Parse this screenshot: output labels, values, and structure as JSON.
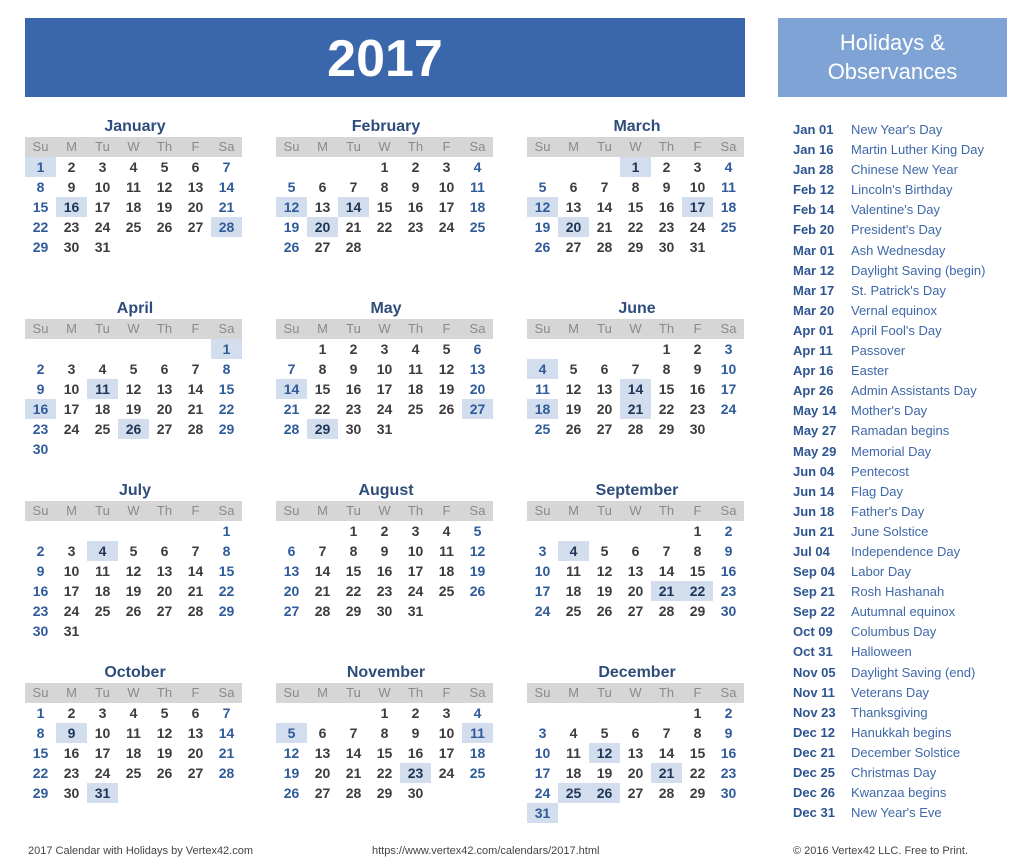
{
  "title": "2017",
  "holidays_title_1": "Holidays &",
  "holidays_title_2": "Observances",
  "weekdays": [
    "Su",
    "M",
    "Tu",
    "W",
    "Th",
    "F",
    "Sa"
  ],
  "months": [
    {
      "name": "January",
      "start": 0,
      "days": 31,
      "hl": [
        1,
        16,
        28
      ]
    },
    {
      "name": "February",
      "start": 3,
      "days": 28,
      "hl": [
        12,
        14,
        20
      ]
    },
    {
      "name": "March",
      "start": 3,
      "days": 31,
      "hl": [
        1,
        12,
        17,
        20
      ]
    },
    {
      "name": "April",
      "start": 6,
      "days": 30,
      "hl": [
        1,
        11,
        16,
        26
      ]
    },
    {
      "name": "May",
      "start": 1,
      "days": 31,
      "hl": [
        14,
        27,
        29
      ]
    },
    {
      "name": "June",
      "start": 4,
      "days": 30,
      "hl": [
        4,
        14,
        18,
        21
      ]
    },
    {
      "name": "July",
      "start": 6,
      "days": 31,
      "hl": [
        4
      ]
    },
    {
      "name": "August",
      "start": 2,
      "days": 31,
      "hl": []
    },
    {
      "name": "September",
      "start": 5,
      "days": 30,
      "hl": [
        4,
        21,
        22
      ]
    },
    {
      "name": "October",
      "start": 0,
      "days": 31,
      "hl": [
        9,
        31
      ]
    },
    {
      "name": "November",
      "start": 3,
      "days": 30,
      "hl": [
        5,
        11,
        23
      ]
    },
    {
      "name": "December",
      "start": 5,
      "days": 31,
      "hl": [
        12,
        21,
        25,
        26,
        31
      ]
    }
  ],
  "holidays": [
    [
      "Jan 01",
      "New Year's Day"
    ],
    [
      "Jan 16",
      "Martin Luther King Day"
    ],
    [
      "Jan 28",
      "Chinese New Year"
    ],
    [
      "Feb 12",
      "Lincoln's Birthday"
    ],
    [
      "Feb 14",
      "Valentine's Day"
    ],
    [
      "Feb 20",
      "President's Day"
    ],
    [
      "Mar 01",
      "Ash Wednesday"
    ],
    [
      "Mar 12",
      "Daylight Saving (begin)"
    ],
    [
      "Mar 17",
      "St. Patrick's Day"
    ],
    [
      "Mar 20",
      "Vernal equinox"
    ],
    [
      "Apr 01",
      "April Fool's Day"
    ],
    [
      "Apr 11",
      "Passover"
    ],
    [
      "Apr 16",
      "Easter"
    ],
    [
      "Apr 26",
      "Admin Assistants Day"
    ],
    [
      "May 14",
      "Mother's Day"
    ],
    [
      "May 27",
      "Ramadan begins"
    ],
    [
      "May 29",
      "Memorial Day"
    ],
    [
      "Jun 04",
      "Pentecost"
    ],
    [
      "Jun 14",
      "Flag Day"
    ],
    [
      "Jun 18",
      "Father's Day"
    ],
    [
      "Jun 21",
      "June Solstice"
    ],
    [
      "Jul 04",
      "Independence Day"
    ],
    [
      "Sep 04",
      "Labor Day"
    ],
    [
      "Sep 21",
      "Rosh Hashanah"
    ],
    [
      "Sep 22",
      "Autumnal equinox"
    ],
    [
      "Oct 09",
      "Columbus Day"
    ],
    [
      "Oct 31",
      "Halloween"
    ],
    [
      "Nov 05",
      "Daylight Saving (end)"
    ],
    [
      "Nov 11",
      "Veterans Day"
    ],
    [
      "Nov 23",
      "Thanksgiving"
    ],
    [
      "Dec 12",
      "Hanukkah begins"
    ],
    [
      "Dec 21",
      "December Solstice"
    ],
    [
      "Dec 25",
      "Christmas Day"
    ],
    [
      "Dec 26",
      "Kwanzaa begins"
    ],
    [
      "Dec 31",
      "New Year's Eve"
    ]
  ],
  "footer": {
    "left": "2017 Calendar with Holidays by Vertex42.com",
    "center": "https://www.vertex42.com/calendars/2017.html",
    "right": "© 2016 Vertex42 LLC. Free to Print."
  }
}
